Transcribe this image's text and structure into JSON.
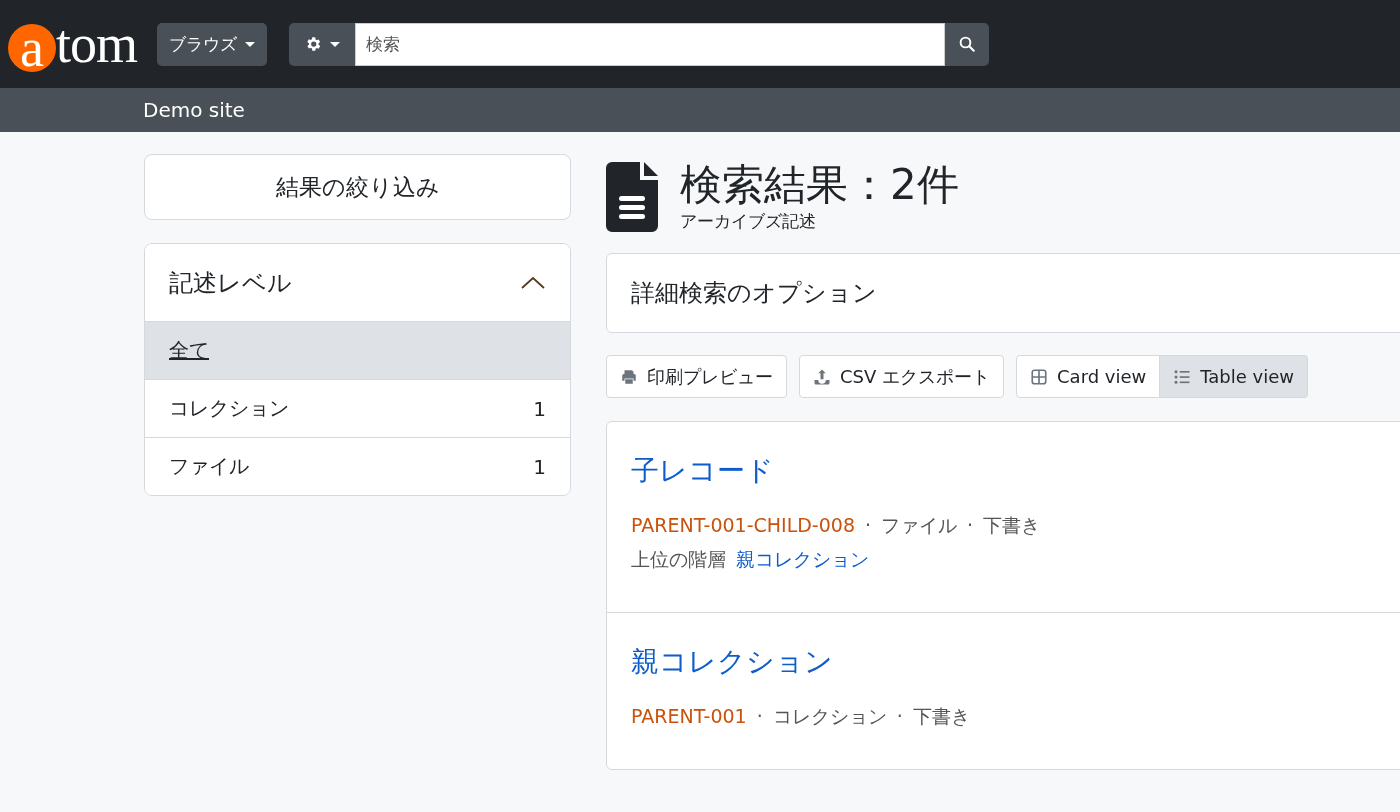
{
  "header": {
    "logo": {
      "first": "a",
      "rest": "tom"
    },
    "browse_button": "ブラウズ",
    "search": {
      "placeholder": "検索"
    }
  },
  "site_bar": {
    "site_name": "Demo site"
  },
  "sidebar": {
    "filter_button": "結果の絞り込み",
    "facet": {
      "title": "記述レベル",
      "expanded": true,
      "items": [
        {
          "label": "全て",
          "selected": true
        },
        {
          "label": "コレクション",
          "count": "1",
          "selected": false
        },
        {
          "label": "ファイル",
          "count": "1",
          "selected": false
        }
      ]
    }
  },
  "main": {
    "title": "検索結果：2件",
    "subtitle": "アーカイブズ記述",
    "advanced_search": "詳細検索のオプション",
    "actions": [
      {
        "label": "印刷プレビュー",
        "kind": "print"
      },
      {
        "label": "CSV エクスポート",
        "kind": "export"
      }
    ],
    "views": [
      {
        "label": "Card view",
        "kind": "card",
        "selected": false
      },
      {
        "label": "Table view",
        "kind": "table",
        "selected": true
      }
    ],
    "results": [
      {
        "title": "子レコード",
        "meta": [
          {
            "kind": "identifier",
            "text": "PARENT-001-CHILD-008"
          },
          {
            "kind": "separator",
            "text": "·"
          },
          {
            "kind": "level",
            "text": "ファイル"
          },
          {
            "kind": "separator",
            "text": "·"
          },
          {
            "kind": "status",
            "text": "下書き"
          }
        ],
        "part_of": {
          "label": "上位の階層",
          "link": "親コレクション"
        }
      },
      {
        "title": "親コレクション",
        "meta": [
          {
            "kind": "identifier",
            "text": "PARENT-001"
          },
          {
            "kind": "separator",
            "text": "·"
          },
          {
            "kind": "level",
            "text": "コレクション"
          },
          {
            "kind": "separator",
            "text": "·"
          },
          {
            "kind": "status",
            "text": "下書き"
          }
        ]
      }
    ]
  }
}
